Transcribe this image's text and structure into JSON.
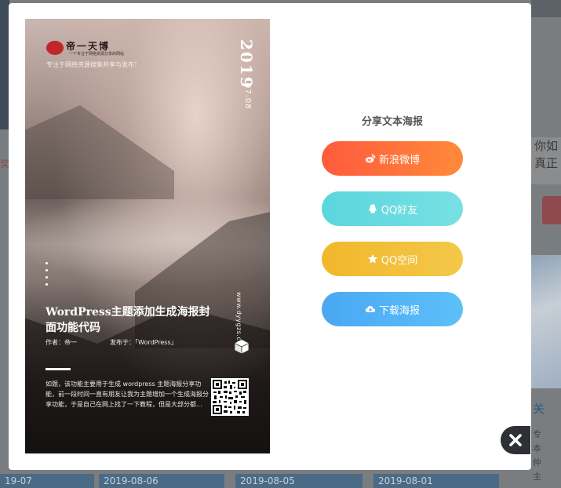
{
  "background": {
    "right_text": [
      "你如",
      "真正"
    ],
    "right_link": "关",
    "right_small": [
      "专",
      "本",
      "仲",
      "主"
    ],
    "left_strip": "奖",
    "dates": [
      "19-07",
      "2019-08-06",
      "2019-08-05",
      "2019-08-01"
    ]
  },
  "poster": {
    "logo_text": "帝一天博",
    "logo_sub": "一个专注于网络资源分享的网站",
    "tagline": "专注于网络资源搜集共享与发布！",
    "year": "2019",
    "date": "07.08",
    "title": "WordPress主题添加生成海报封面功能代码",
    "author": "作者：帝一",
    "published": "发布于：「WordPress」",
    "url": "www.dyygzs.com",
    "excerpt": "如题，该功能主要用于生成 wordpress 主题海报分享功能，前一段时间一直有朋友让我为主题增加一个生成海报分享功能，于是自己在网上找了一下教程，但是大部分都..."
  },
  "share": {
    "title": "分享文本海报",
    "buttons": [
      {
        "label": "新浪微博",
        "icon": "weibo-icon",
        "color": "#ff6a3a"
      },
      {
        "label": "QQ好友",
        "icon": "qq-icon",
        "color": "#62d9de"
      },
      {
        "label": "QQ空间",
        "icon": "star-icon",
        "color": "#f2bd34"
      },
      {
        "label": "下载海报",
        "icon": "cloud-download-icon",
        "color": "#50b2f6"
      }
    ]
  },
  "close": {
    "icon": "close-icon"
  }
}
